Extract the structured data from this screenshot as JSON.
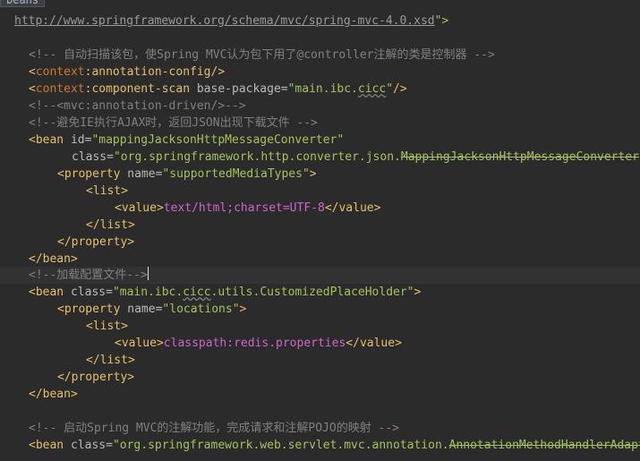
{
  "breadcrumb": "beans",
  "lines": {
    "l1_url": "http://www.springframework.org/schema/mvc/spring-mvc-4.0.xsd",
    "l1_end": "\">",
    "l2": "<!-- 自动扫描该包，使Spring MVC认为包下用了@controller注解的类是控制器 -->",
    "l3_open": "<",
    "l3_ns": "context",
    "l3_rest": ":annotation-config/>",
    "l4_open": "<",
    "l4_ns": "context",
    "l4_rest": ":component-scan ",
    "l4_attr": "base-package=",
    "l4_q1": "\"main.ibc.",
    "l4_ul": "cicc",
    "l4_q2": "\"",
    "l4_close": "/>",
    "l5": "<!--<mvc:annotation-driven/>-->",
    "l6": "<!--避免IE执行AJAX时，返回JSON出现下载文件 -->",
    "l7_open": "<bean ",
    "l7_attr": "id=",
    "l7_val": "\"mappingJacksonHttpMessageConverter\"",
    "l8_attr": "class=",
    "l8_val": "\"org.springframework.http.converter.json.",
    "l8_strike": "MappingJacksonHttpMessageConverter",
    "l9_open": "<property ",
    "l9_attr": "name=",
    "l9_val": "\"supportedMediaTypes\"",
    "l9_close": ">",
    "l10": "<list>",
    "l11_open": "<value>",
    "l11_val": "text/html;charset=UTF-8",
    "l11_close": "</value>",
    "l12": "</list>",
    "l13": "</property>",
    "l14": "</bean>",
    "l15": "<!--加载配置文件-->",
    "l16_open": "<bean ",
    "l16_attr": "class=",
    "l16_q1": "\"main.ibc.",
    "l16_ul": "cicc",
    "l16_q2": ".utils.CustomizedPlaceHolder\"",
    "l16_close": ">",
    "l17_open": "<property ",
    "l17_attr": "name=",
    "l17_val": "\"locations\"",
    "l17_close": ">",
    "l18": "<list>",
    "l19_open": "<value>",
    "l19_val": "classpath:redis.properties",
    "l19_close": "</value>",
    "l20": "</list>",
    "l21": "</property>",
    "l22": "</bean>",
    "l24": "<!-- 启动Spring MVC的注解功能，完成请求和注解POJO的映射 -->",
    "l25_open": "<bean ",
    "l25_attr": "class=",
    "l25_val": "\"org.springframework.web.servlet.mvc.annotation.",
    "l25_strike": "AnnotationMethodHandlerAdapter\""
  }
}
